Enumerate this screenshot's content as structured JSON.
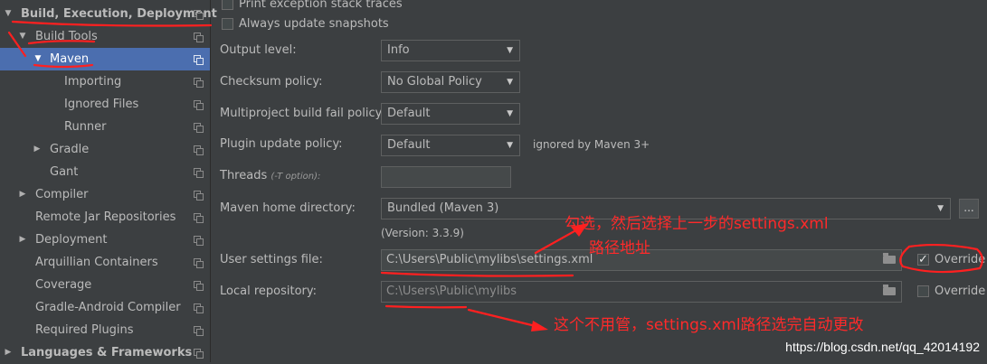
{
  "sidebar": {
    "items": [
      {
        "label": "Build, Execution, Deployment",
        "arrow": "▼",
        "bold": true
      },
      {
        "label": "Build Tools",
        "arrow": "▼"
      },
      {
        "label": "Maven",
        "arrow": "▼",
        "selected": true
      },
      {
        "label": "Importing"
      },
      {
        "label": "Ignored Files"
      },
      {
        "label": "Runner"
      },
      {
        "label": "Gradle",
        "arrow": "▶"
      },
      {
        "label": "Gant"
      },
      {
        "label": "Compiler",
        "arrow": "▶"
      },
      {
        "label": "Remote Jar Repositories"
      },
      {
        "label": "Deployment",
        "arrow": "▶"
      },
      {
        "label": "Arquillian Containers"
      },
      {
        "label": "Coverage"
      },
      {
        "label": "Gradle-Android Compiler"
      },
      {
        "label": "Required Plugins"
      },
      {
        "label": "Languages & Frameworks",
        "arrow": "▶",
        "bold": true
      }
    ]
  },
  "checkboxes": {
    "print_exception": "Print exception stack traces",
    "always_update": "Always update snapshots"
  },
  "fields": {
    "output_level": {
      "label": "Output level:",
      "value": "Info"
    },
    "checksum_policy": {
      "label": "Checksum policy:",
      "value": "No Global Policy"
    },
    "multiproject_fail": {
      "label": "Multiproject build fail policy:",
      "value": "Default"
    },
    "plugin_update": {
      "label": "Plugin update policy:",
      "value": "Default",
      "hint": "ignored by Maven 3+"
    },
    "threads": {
      "label": "Threads",
      "hint": "(-T option):",
      "value": ""
    },
    "maven_home": {
      "label": "Maven home directory:",
      "value": "Bundled (Maven 3)",
      "version": "(Version: 3.3.9)",
      "browse": "..."
    },
    "user_settings": {
      "label": "User settings file:",
      "value": "C:\\Users\\Public\\mylibs\\settings.xml",
      "override": "Override",
      "override_checked": true
    },
    "local_repo": {
      "label": "Local repository:",
      "value": "C:\\Users\\Public\\mylibs",
      "override": "Override",
      "override_checked": false
    }
  },
  "annotations": {
    "top_line1": "勾选，然后选择上一步的settings.xml",
    "top_line2": "路径地址",
    "bottom": "这个不用管，settings.xml路径选完自动更改"
  },
  "watermark": "https://blog.csdn.net/qq_42014192",
  "colors": {
    "annotation": "#ff2a2a",
    "selected": "#4b6eaf",
    "background": "#3c3f41"
  }
}
